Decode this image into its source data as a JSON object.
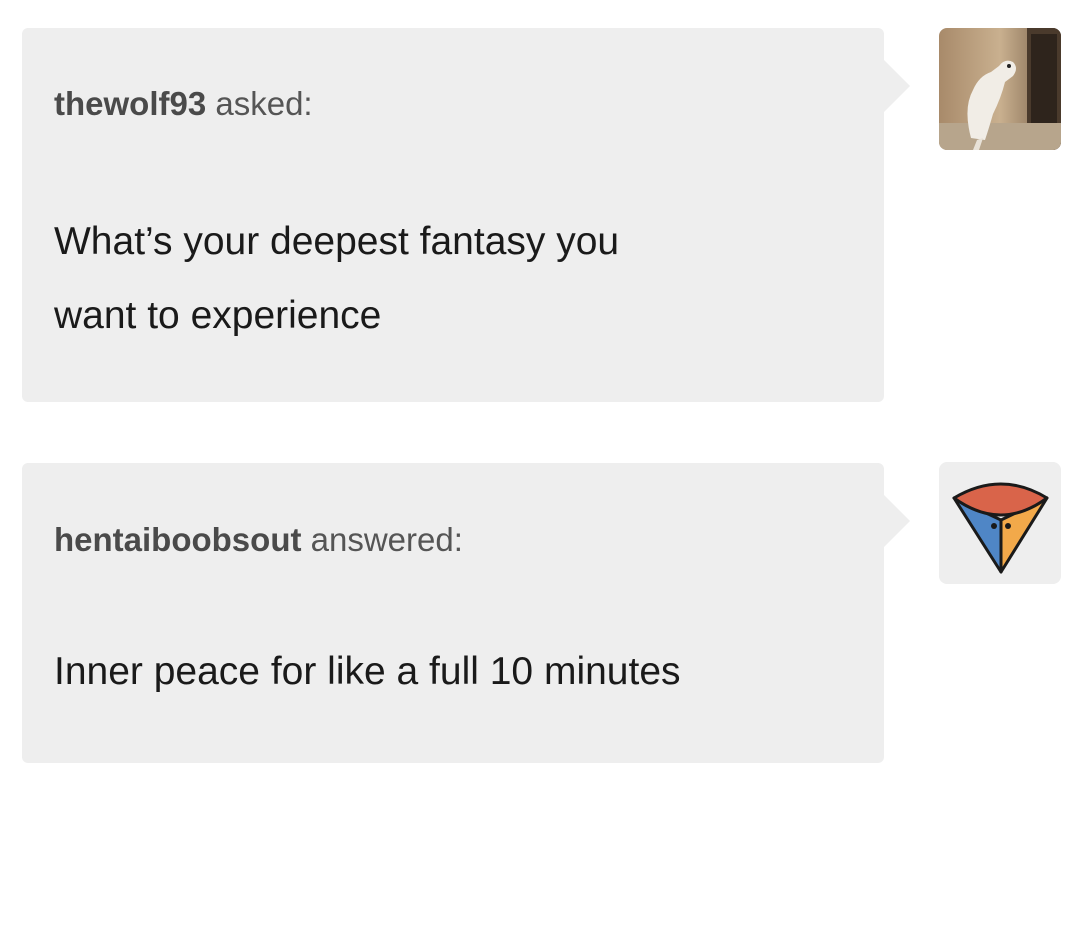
{
  "ask": {
    "username": "thewolf93",
    "verb": "asked:",
    "question_line1": "What’s your deepest fantasy you",
    "question_line2": "want to experience",
    "avatar_icon": "dog-photo-avatar"
  },
  "answer": {
    "username": "hentaiboobsout",
    "verb": "answered:",
    "text": "Inner peace for like a full 10 minutes",
    "avatar_icon": "pizza-slice-avatar"
  },
  "colors": {
    "bubble": "#eeeeee",
    "username": "#4a4a4a",
    "body_text": "#1a1a1a"
  }
}
